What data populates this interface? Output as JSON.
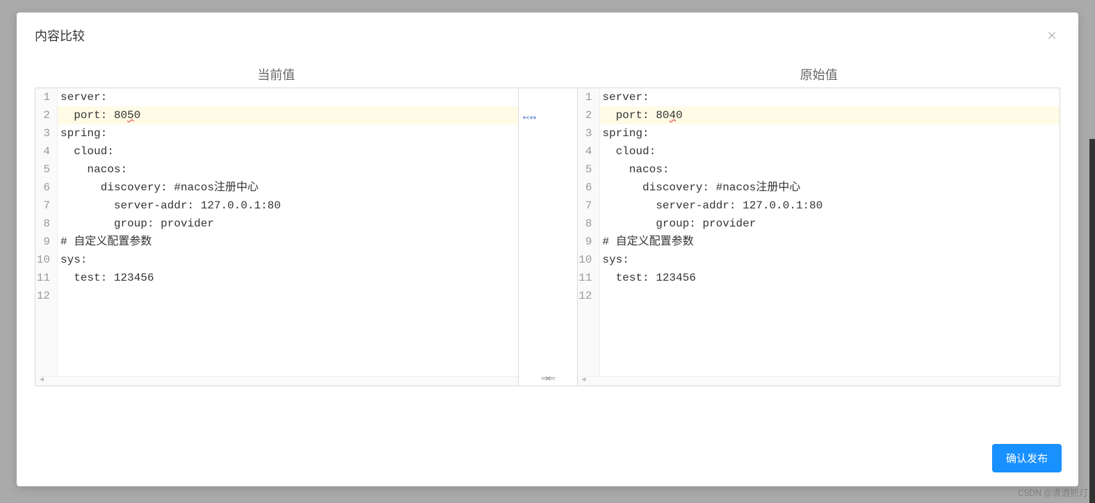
{
  "modal": {
    "title": "内容比较",
    "close_icon": "close",
    "left_title": "当前值",
    "right_title": "原始值",
    "confirm_label": "确认发布",
    "center_marker": "↢↭"
  },
  "diff": {
    "left": {
      "lines": [
        {
          "n": 1,
          "text": "server:",
          "changed": false
        },
        {
          "n": 2,
          "text": "  port: 8050",
          "changed": true,
          "ch_pre": "  port: 80",
          "ch_hl": "5",
          "ch_post": "0"
        },
        {
          "n": 3,
          "text": "spring:",
          "changed": false
        },
        {
          "n": 4,
          "text": "  cloud:",
          "changed": false
        },
        {
          "n": 5,
          "text": "    nacos:",
          "changed": false
        },
        {
          "n": 6,
          "text": "      discovery: #nacos注册中心",
          "changed": false
        },
        {
          "n": 7,
          "text": "        server-addr: 127.0.0.1:80",
          "changed": false
        },
        {
          "n": 8,
          "text": "        group: provider",
          "changed": false
        },
        {
          "n": 9,
          "text": "# 自定义配置参数",
          "changed": false
        },
        {
          "n": 10,
          "text": "sys:",
          "changed": false
        },
        {
          "n": 11,
          "text": "  test: 123456",
          "changed": false
        },
        {
          "n": 12,
          "text": "",
          "changed": false
        }
      ]
    },
    "right": {
      "lines": [
        {
          "n": 1,
          "text": "server:",
          "changed": false
        },
        {
          "n": 2,
          "text": "  port: 8040",
          "changed": true,
          "ch_pre": "  port: 80",
          "ch_hl": "4",
          "ch_post": "0"
        },
        {
          "n": 3,
          "text": "spring:",
          "changed": false
        },
        {
          "n": 4,
          "text": "  cloud:",
          "changed": false
        },
        {
          "n": 5,
          "text": "    nacos:",
          "changed": false
        },
        {
          "n": 6,
          "text": "      discovery: #nacos注册中心",
          "changed": false
        },
        {
          "n": 7,
          "text": "        server-addr: 127.0.0.1:80",
          "changed": false
        },
        {
          "n": 8,
          "text": "        group: provider",
          "changed": false
        },
        {
          "n": 9,
          "text": "# 自定义配置参数",
          "changed": false
        },
        {
          "n": 10,
          "text": "sys:",
          "changed": false
        },
        {
          "n": 11,
          "text": "  test: 123456",
          "changed": false
        },
        {
          "n": 12,
          "text": "",
          "changed": false
        }
      ]
    }
  },
  "watermark": "CSDN @清酒抓灯"
}
